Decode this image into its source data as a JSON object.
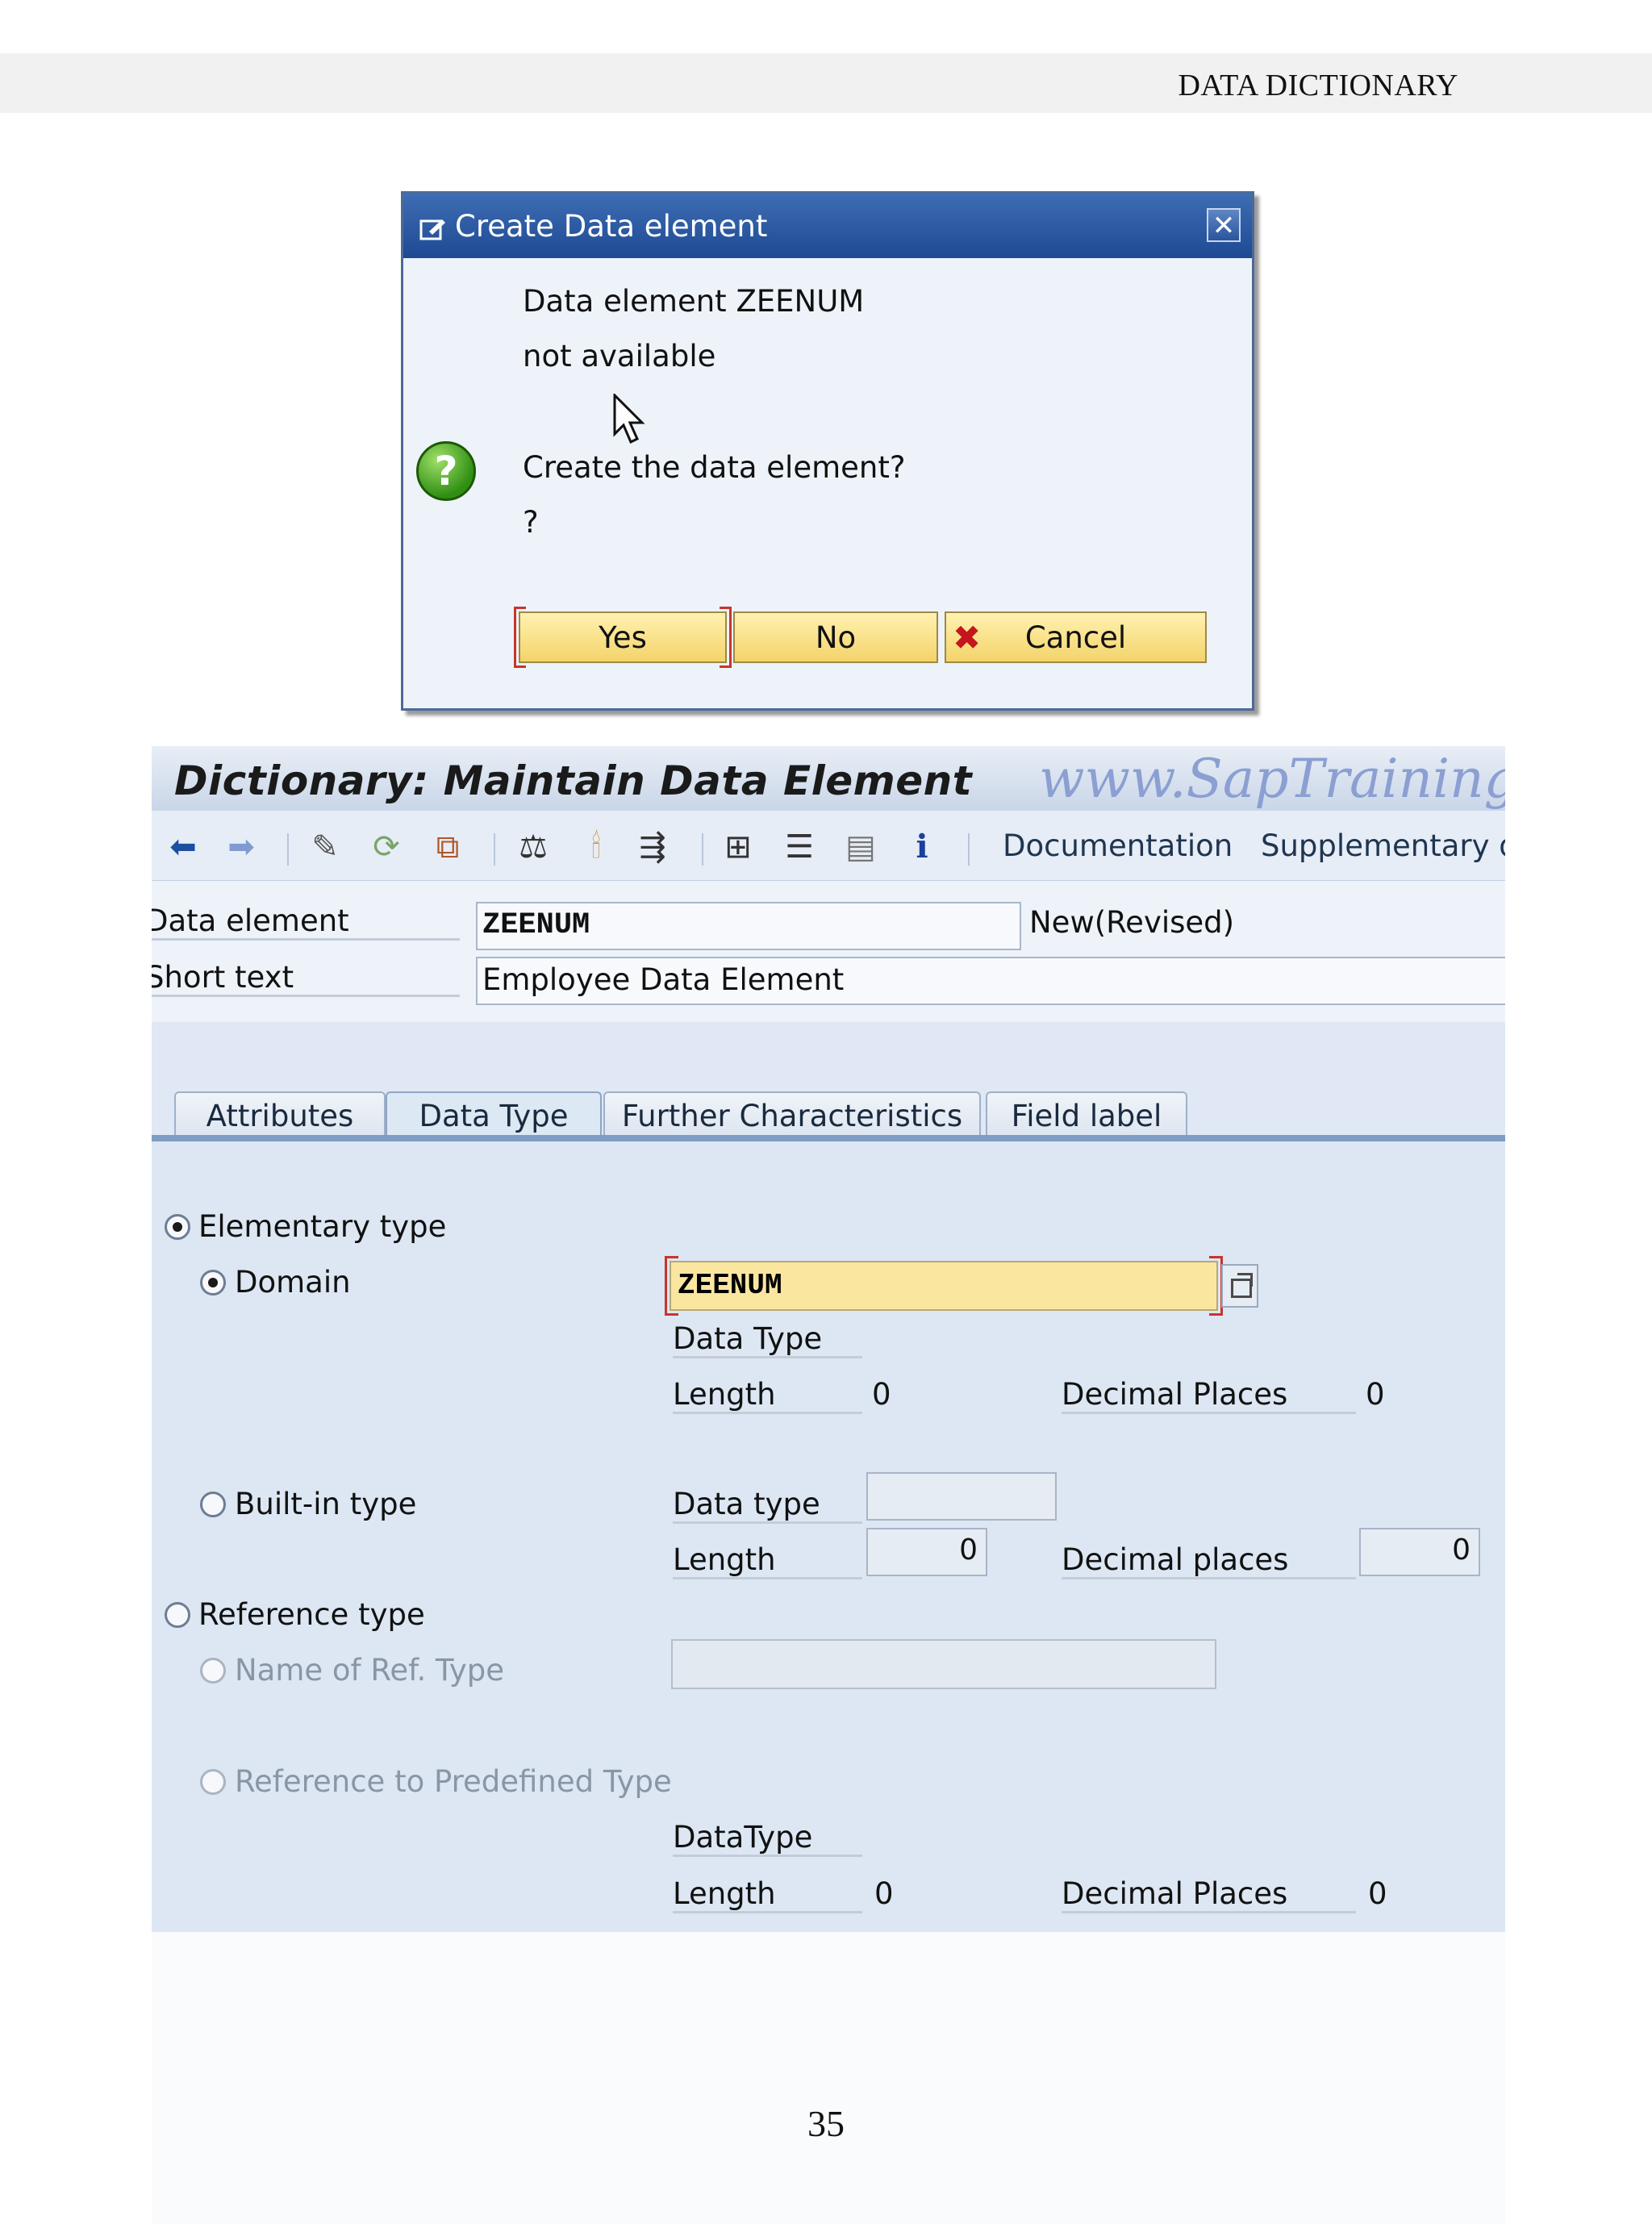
{
  "header": {
    "section_title": "DATA DICTIONARY"
  },
  "dialog": {
    "title": "Create Data element",
    "line1": "Data element ZEENUM",
    "line2": "not available",
    "line3": "Create the data element?",
    "line4": "?",
    "yes_label": "Yes",
    "no_label": "No",
    "cancel_label": "Cancel"
  },
  "screen": {
    "title": "Dictionary: Maintain Data Element",
    "watermark": "www.SapTraining",
    "toolbar": {
      "documentation_label": "Documentation",
      "supplementary_label": "Supplementary dc"
    },
    "data_element_label": "Data element",
    "data_element_value": "ZEENUM",
    "status": "New(Revised)",
    "short_text_label": "Short text",
    "short_text_value": "Employee Data Element",
    "tabs": [
      "Attributes",
      "Data Type",
      "Further Characteristics",
      "Field label"
    ],
    "elementary_type_label": "Elementary type",
    "domain_label": "Domain",
    "domain_value": "ZEENUM",
    "domain_data_type_label": "Data Type",
    "domain_length_label": "Length",
    "domain_length_value": "0",
    "domain_decimal_label": "Decimal Places",
    "domain_decimal_value": "0",
    "builtin_label": "Built-in type",
    "builtin_data_type_label": "Data type",
    "builtin_length_label": "Length",
    "builtin_length_value": "0",
    "builtin_decimal_label": "Decimal places",
    "builtin_decimal_value": "0",
    "reference_type_label": "Reference type",
    "name_ref_type_label": "Name of Ref. Type",
    "ref_predefined_label": "Reference to Predefined Type",
    "ref_data_type_label": "DataType",
    "ref_length_label": "Length",
    "ref_length_value": "0",
    "ref_decimal_label": "Decimal Places",
    "ref_decimal_value": "0"
  },
  "page_number": "35",
  "colors": {
    "dialog_title": "#2a5aa3",
    "button_yellow": "#f4d36b",
    "domain_highlight": "#fbe6a0"
  }
}
